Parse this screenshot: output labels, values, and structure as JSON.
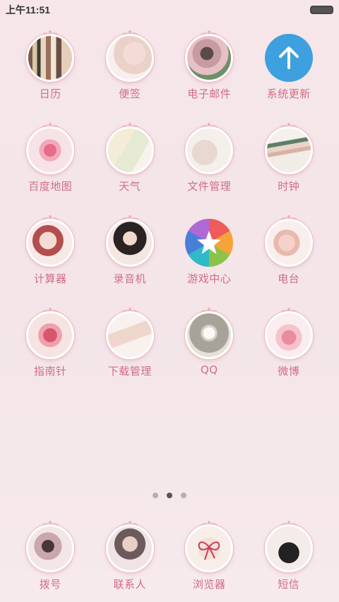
{
  "status": {
    "time": "上午11:51"
  },
  "apps": [
    {
      "label": "日历",
      "icon": "books-icon",
      "style": "f-books"
    },
    {
      "label": "便签",
      "icon": "notes-photo-icon",
      "style": "f-hand"
    },
    {
      "label": "电子邮件",
      "icon": "email-photo-icon",
      "style": "f-hat"
    },
    {
      "label": "系统更新",
      "icon": "update-arrow-icon",
      "style": "f-update"
    },
    {
      "label": "百度地图",
      "icon": "map-rose-icon",
      "style": "f-rose"
    },
    {
      "label": "天气",
      "icon": "weather-curtain-icon",
      "style": "f-curtain"
    },
    {
      "label": "文件管理",
      "icon": "files-bed-icon",
      "style": "f-bed"
    },
    {
      "label": "时钟",
      "icon": "clock-books-icon",
      "style": "f-books2"
    },
    {
      "label": "计算器",
      "icon": "calculator-girl-icon",
      "style": "f-girl1"
    },
    {
      "label": "录音机",
      "icon": "recorder-girl-icon",
      "style": "f-girl2"
    },
    {
      "label": "游戏中心",
      "icon": "game-star-icon",
      "style": "f-star"
    },
    {
      "label": "电台",
      "icon": "radio-photo-icon",
      "style": "f-skull"
    },
    {
      "label": "指南针",
      "icon": "compass-flower-icon",
      "style": "f-flower"
    },
    {
      "label": "下载管理",
      "icon": "download-legs-icon",
      "style": "f-legs"
    },
    {
      "label": "QQ",
      "icon": "qq-cup-icon",
      "style": "f-cup"
    },
    {
      "label": "微博",
      "icon": "weibo-rose-icon",
      "style": "f-rose2"
    }
  ],
  "page_indicator": {
    "pages": 3,
    "active": 2
  },
  "dock": [
    {
      "label": "拨号",
      "icon": "dialer-photo-icon",
      "style": "f-dial"
    },
    {
      "label": "联系人",
      "icon": "contacts-photo-icon",
      "style": "f-contact"
    },
    {
      "label": "浏览器",
      "icon": "browser-bow-icon",
      "style": "f-bow"
    },
    {
      "label": "短信",
      "icon": "sms-suit-icon",
      "style": "f-suit"
    }
  ],
  "colors": {
    "label": "#d06e86",
    "ring": "#f0b8c4",
    "update_blue": "#3ea0de"
  }
}
